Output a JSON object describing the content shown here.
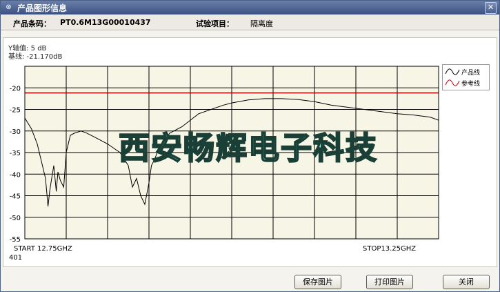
{
  "window": {
    "title": "产品图形信息",
    "close_glyph": "✕",
    "app_glyph": "⊗"
  },
  "info": {
    "barcode_label": "产品条码：",
    "barcode_value": "PT0.6M13G00010437",
    "test_label": "试验项目：",
    "test_value": "隔离度"
  },
  "plot": {
    "y_div_text": "Y轴值: 5 dB",
    "ref_text": "基线: -21.170dB",
    "start_text": "START 12.75GHZ",
    "stop_text": "STOP13.25GHZ",
    "points_text": "401",
    "grid_bg": "#f7f5e6",
    "curve_color": "#000000",
    "ref_color": "#a00000",
    "legend": [
      {
        "label": "产品线",
        "color": "#000000"
      },
      {
        "label": "参考线",
        "color": "#c00000"
      }
    ]
  },
  "chart_data": {
    "type": "line",
    "xlabel": "",
    "ylabel": "",
    "xlim": [
      12.75,
      13.25
    ],
    "ylim": [
      -55,
      -15
    ],
    "yticks": [
      -20,
      -25,
      -30,
      -35,
      -40,
      -45,
      -50,
      -55
    ],
    "ytick_labels": [
      "-20",
      "-25",
      "-30",
      "-35",
      "-40",
      "-45",
      "-50",
      "-55"
    ],
    "grid": true,
    "legend_position": "right",
    "reference_line": {
      "name": "参考线",
      "y": -21.17
    },
    "series": [
      {
        "name": "产品线",
        "x": [
          12.75,
          12.758,
          12.765,
          12.77,
          12.775,
          12.778,
          12.78,
          12.782,
          12.785,
          12.788,
          12.79,
          12.793,
          12.797,
          12.8,
          12.805,
          12.81,
          12.818,
          12.825,
          12.835,
          12.85,
          12.865,
          12.875,
          12.88,
          12.885,
          12.89,
          12.895,
          12.9,
          12.903,
          12.907,
          12.91,
          12.915,
          12.92,
          12.925,
          12.93,
          12.94,
          12.95,
          12.96,
          12.975,
          12.99,
          13.0,
          13.02,
          13.04,
          13.06,
          13.08,
          13.1,
          13.12,
          13.14,
          13.16,
          13.18,
          13.2,
          13.22,
          13.24,
          13.25
        ],
        "y": [
          -27,
          -29.5,
          -33,
          -37,
          -41,
          -47.5,
          -44,
          -41.5,
          -38,
          -44,
          -39.5,
          -41.5,
          -43,
          -35,
          -31,
          -30.5,
          -30,
          -30.5,
          -31.5,
          -33,
          -35,
          -38,
          -43,
          -41,
          -45,
          -47,
          -42,
          -38,
          -36.5,
          -35,
          -33,
          -32,
          -30.5,
          -30,
          -29,
          -27.5,
          -26,
          -25,
          -24,
          -23.5,
          -22.8,
          -22.5,
          -22.5,
          -22.7,
          -23.2,
          -24,
          -24.5,
          -25,
          -25.5,
          -26,
          -26.3,
          -26.8,
          -27.5
        ]
      }
    ]
  },
  "watermark": "西安畅辉电子科技",
  "buttons": {
    "save": "保存图片",
    "print": "打印图片",
    "close": "关闭"
  }
}
